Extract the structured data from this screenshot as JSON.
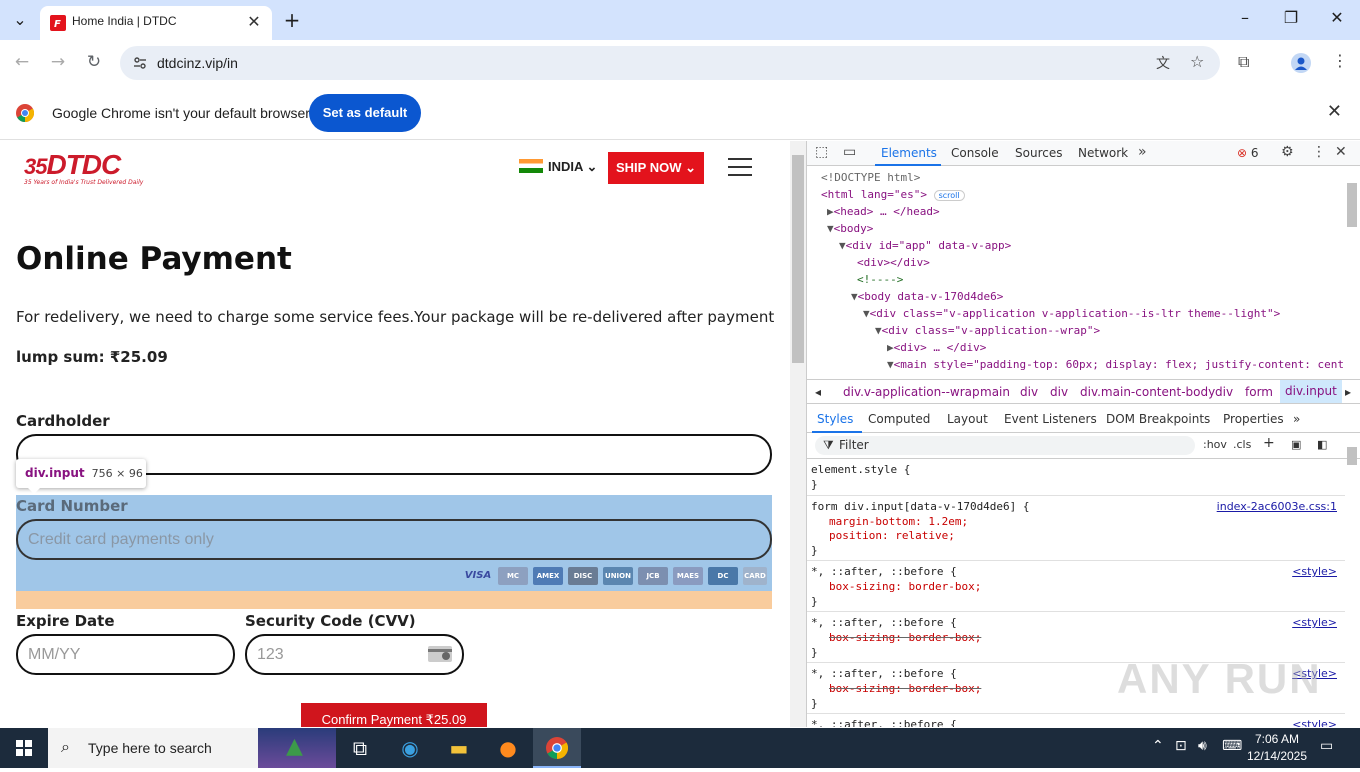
{
  "browser": {
    "tab_title": "Home India | DTDC",
    "url": "dtdcinz.vip/in",
    "infobar_text": "Google Chrome isn't your default browser",
    "set_default_label": "Set as default"
  },
  "site": {
    "logo_text": "DTDC",
    "logo_tagline": "35 Years of India's Trust Delivered Daily",
    "country": "INDIA",
    "ship_now": "SHIP NOW",
    "page_title": "Online Payment",
    "description": "For redelivery, we need to charge some service fees.Your package will be re-delivered after payment",
    "lump_sum": "lump sum: ₹25.09",
    "cardholder_label": "Cardholder",
    "card_number_label": "Card Number",
    "card_number_placeholder": "Credit card payments only",
    "expire_label": "Expire Date",
    "expire_placeholder": "MM/YY",
    "cvv_label": "Security Code (CVV)",
    "cvv_placeholder": "123",
    "confirm_label": "Confirm Payment ₹25.09",
    "card_brands": [
      "VISA",
      "MC",
      "AMEX",
      "DISC",
      "UNION",
      "JCB",
      "MAES",
      "DC",
      "CARD"
    ]
  },
  "inspector_tooltip": {
    "element": "div.input",
    "dims": "756 × 96"
  },
  "devtools": {
    "tabs": [
      "Elements",
      "Console",
      "Sources",
      "Network"
    ],
    "error_count": "6",
    "dom": [
      "<!DOCTYPE html>",
      "<html lang=\"es\">",
      "<head> … </head>",
      "<body>",
      "<div id=\"app\" data-v-app>",
      "<div></div>",
      "<!---->",
      "<body data-v-170d4de6>",
      "<div class=\"v-application v-application--is-ltr theme--light\">",
      "<div class=\"v-application--wrap\">",
      "<div> … </div>",
      "<main style=\"padding-top: 60px; display: flex; justify-content: cent"
    ],
    "scroll_badge": "scroll",
    "breadcrumbs": [
      "div.v-application--wrap",
      "main",
      "div",
      "div",
      "div.main-content-body",
      "div",
      "form",
      "div.input"
    ],
    "subtabs": [
      "Styles",
      "Computed",
      "Layout",
      "Event Listeners",
      "DOM Breakpoints",
      "Properties"
    ],
    "filter_placeholder": "Filter",
    "hov": ":hov",
    "cls": ".cls",
    "rules": [
      {
        "selector": "element.style {",
        "decls": [],
        "source": ""
      },
      {
        "selector": "form div.input[data-v-170d4de6] {",
        "decls": [
          "margin-bottom: 1.2em;",
          "position: relative;"
        ],
        "source": "index-2ac6003e.css:1"
      },
      {
        "selector": "*, ::after, ::before {",
        "decls": [
          "box-sizing: border-box;"
        ],
        "source": "<style>"
      },
      {
        "selector": "*, ::after, ::before {",
        "decls": [
          "box-sizing: border-box;"
        ],
        "source": "<style>"
      },
      {
        "selector": "*, ::after, ::before {",
        "decls": [
          "box-sizing: border-box;"
        ],
        "source": "<style>"
      },
      {
        "selector": "*, ::after, ::before {",
        "decls": [],
        "source": "<style>"
      }
    ],
    "watermark": "ANY RUN"
  },
  "taskbar": {
    "search_placeholder": "Type here to search",
    "time": "7:06 AM",
    "date": "12/14/2025"
  }
}
